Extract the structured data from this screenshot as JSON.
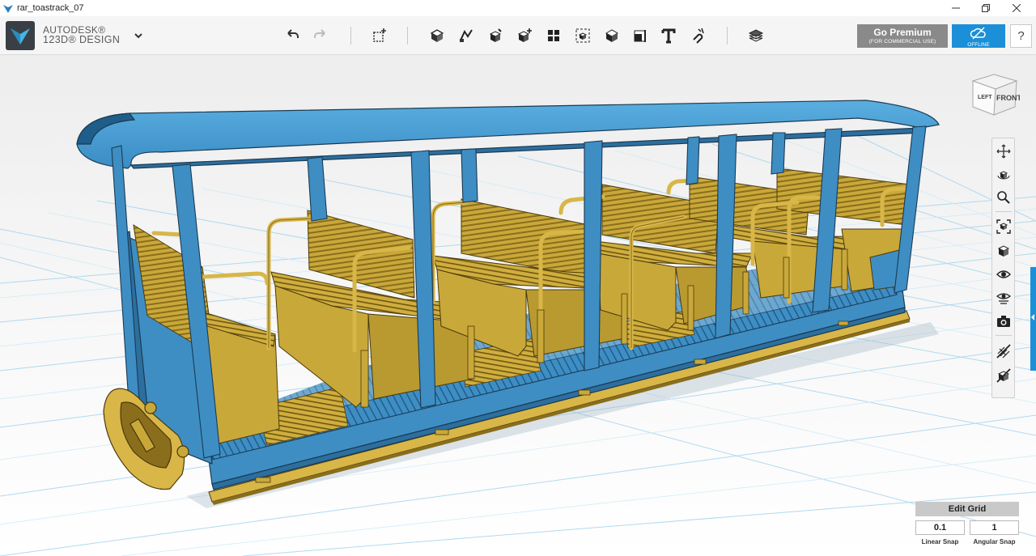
{
  "window": {
    "title": "rar_toastrack_07",
    "controls": [
      "minimize",
      "restore",
      "close"
    ]
  },
  "app": {
    "brand_line1": "AUTODESK®",
    "brand_line2": "123D® DESIGN"
  },
  "toolbar": {
    "tools": [
      {
        "name": "undo-icon"
      },
      {
        "name": "redo-icon"
      },
      {
        "name": "primitives-icon"
      },
      {
        "name": "sketch-icon"
      },
      {
        "name": "construct-icon"
      },
      {
        "name": "modify-icon"
      },
      {
        "name": "pattern-icon"
      },
      {
        "name": "grouping-icon"
      },
      {
        "name": "combine-icon"
      },
      {
        "name": "measure-icon"
      },
      {
        "name": "text-icon"
      },
      {
        "name": "snap-icon"
      },
      {
        "name": "material-icon"
      }
    ]
  },
  "premium": {
    "label": "Go Premium",
    "sublabel": "(FOR COMMERCIAL USE)"
  },
  "offline": {
    "label": "OFFLINE"
  },
  "help": {
    "label": "?"
  },
  "viewcube": {
    "left_label": "LEFT",
    "front_label": "FRONT"
  },
  "navigation": {
    "tools": [
      "pan-icon",
      "orbit-icon",
      "zoom-icon",
      "fit-icon",
      "view-icon",
      "visibility-icon",
      "material-view-icon",
      "screenshot-icon",
      "hide-grid-icon",
      "hide-bodies-icon"
    ]
  },
  "edit_grid": {
    "title": "Edit Grid",
    "linear_snap_value": "0.1",
    "linear_snap_label": "Linear Snap",
    "angular_snap_value": "1",
    "angular_snap_label": "Angular Snap"
  },
  "colors": {
    "accent": "#1b8fd8",
    "body_blue": "#3e8ec4",
    "seat_gold": "#c9a83a",
    "grid_line": "#9fd2ee"
  }
}
